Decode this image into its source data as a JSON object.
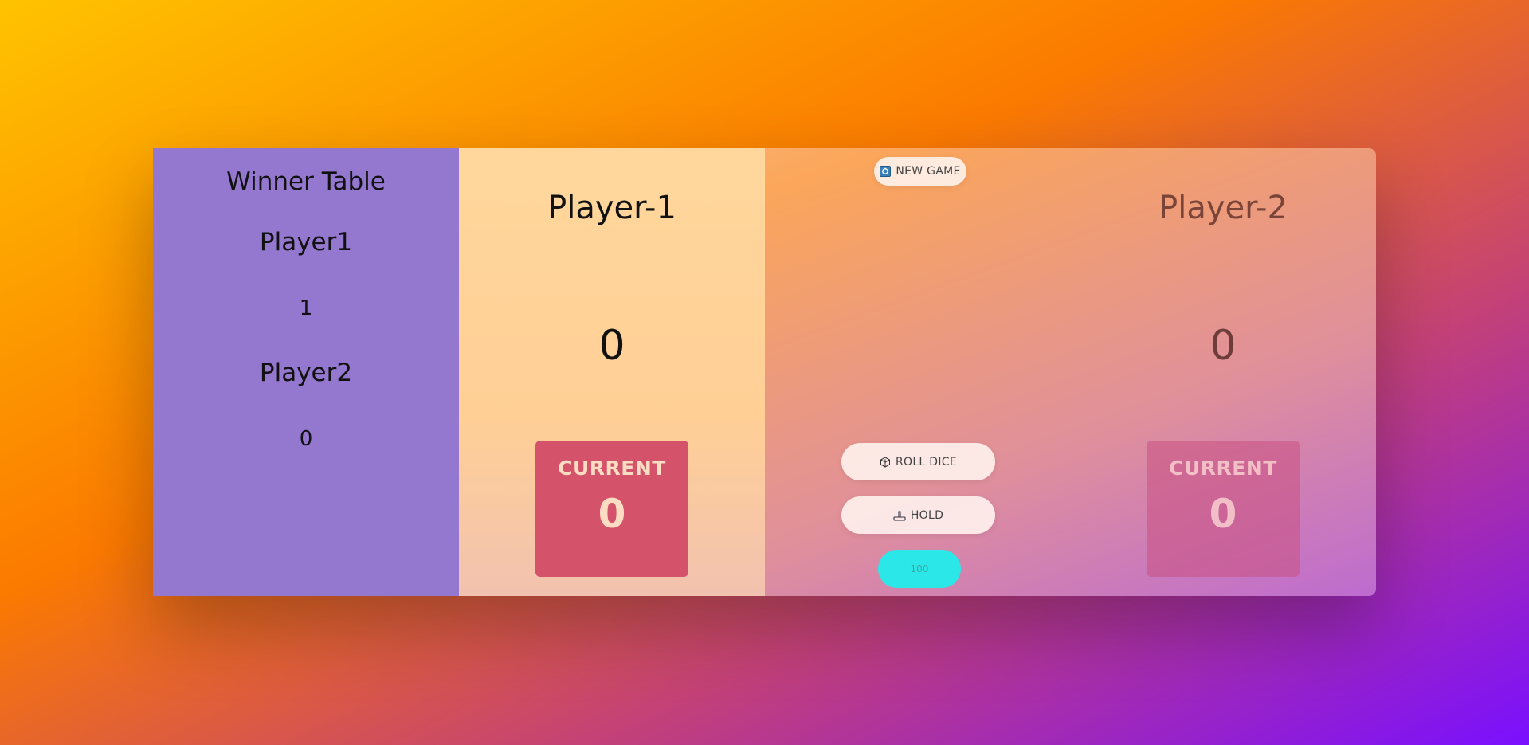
{
  "winner_table": {
    "title": "Winner Table",
    "players": [
      {
        "name": "Player1",
        "wins": "1"
      },
      {
        "name": "Player2",
        "wins": "0"
      }
    ]
  },
  "player1": {
    "name": "Player-1",
    "score": "0",
    "current_label": "CURRENT",
    "current_score": "0"
  },
  "player2": {
    "name": "Player-2",
    "score": "0",
    "current_label": "CURRENT",
    "current_score": "0"
  },
  "controls": {
    "new_game_label": "NEW GAME",
    "new_game_icon": "new-game-icon",
    "roll_dice_label": "ROLL DICE",
    "roll_dice_icon": "dice-icon",
    "hold_label": "HOLD",
    "hold_icon": "hold-icon",
    "target_score_value": "100"
  },
  "colors": {
    "winner_panel": "#9478d0",
    "current_box": "#d4536a",
    "target_input": "#2ce7e8"
  }
}
